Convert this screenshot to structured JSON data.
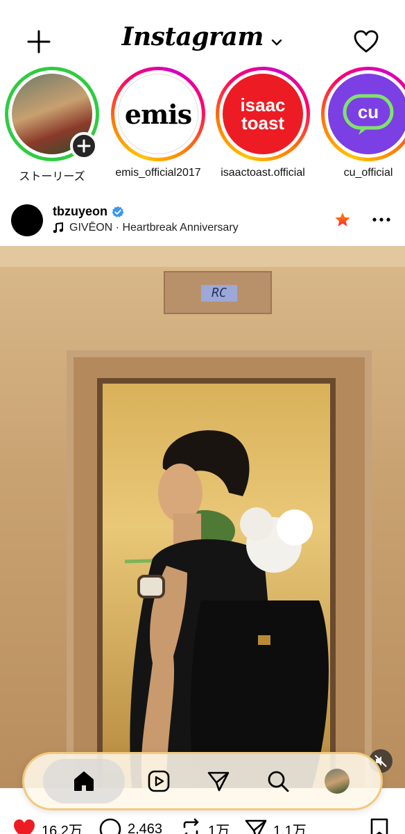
{
  "header": {
    "logo": "Instagram"
  },
  "stories": [
    {
      "name": "ストーリーズ",
      "type": "own"
    },
    {
      "name": "emis_official2017",
      "type": "brand",
      "avatar_text": "emis"
    },
    {
      "name": "isaactoast.official",
      "type": "brand",
      "avatar_text_1": "isaac",
      "avatar_text_2": "toast"
    },
    {
      "name": "cu_official",
      "type": "brand",
      "avatar_text": "cu"
    }
  ],
  "post": {
    "username": "tbzuyeon",
    "music": "GIVĒON · Heartbreak Anniversary",
    "elevator_display": "RC"
  },
  "actions": {
    "likes": "16.2万",
    "comments": "2,463",
    "reposts": "1万",
    "shares": "1.1万"
  },
  "colors": {
    "like_red": "#ed1c24",
    "story_ring_own": "#2ecc40",
    "verified_blue": "#3897f0"
  }
}
